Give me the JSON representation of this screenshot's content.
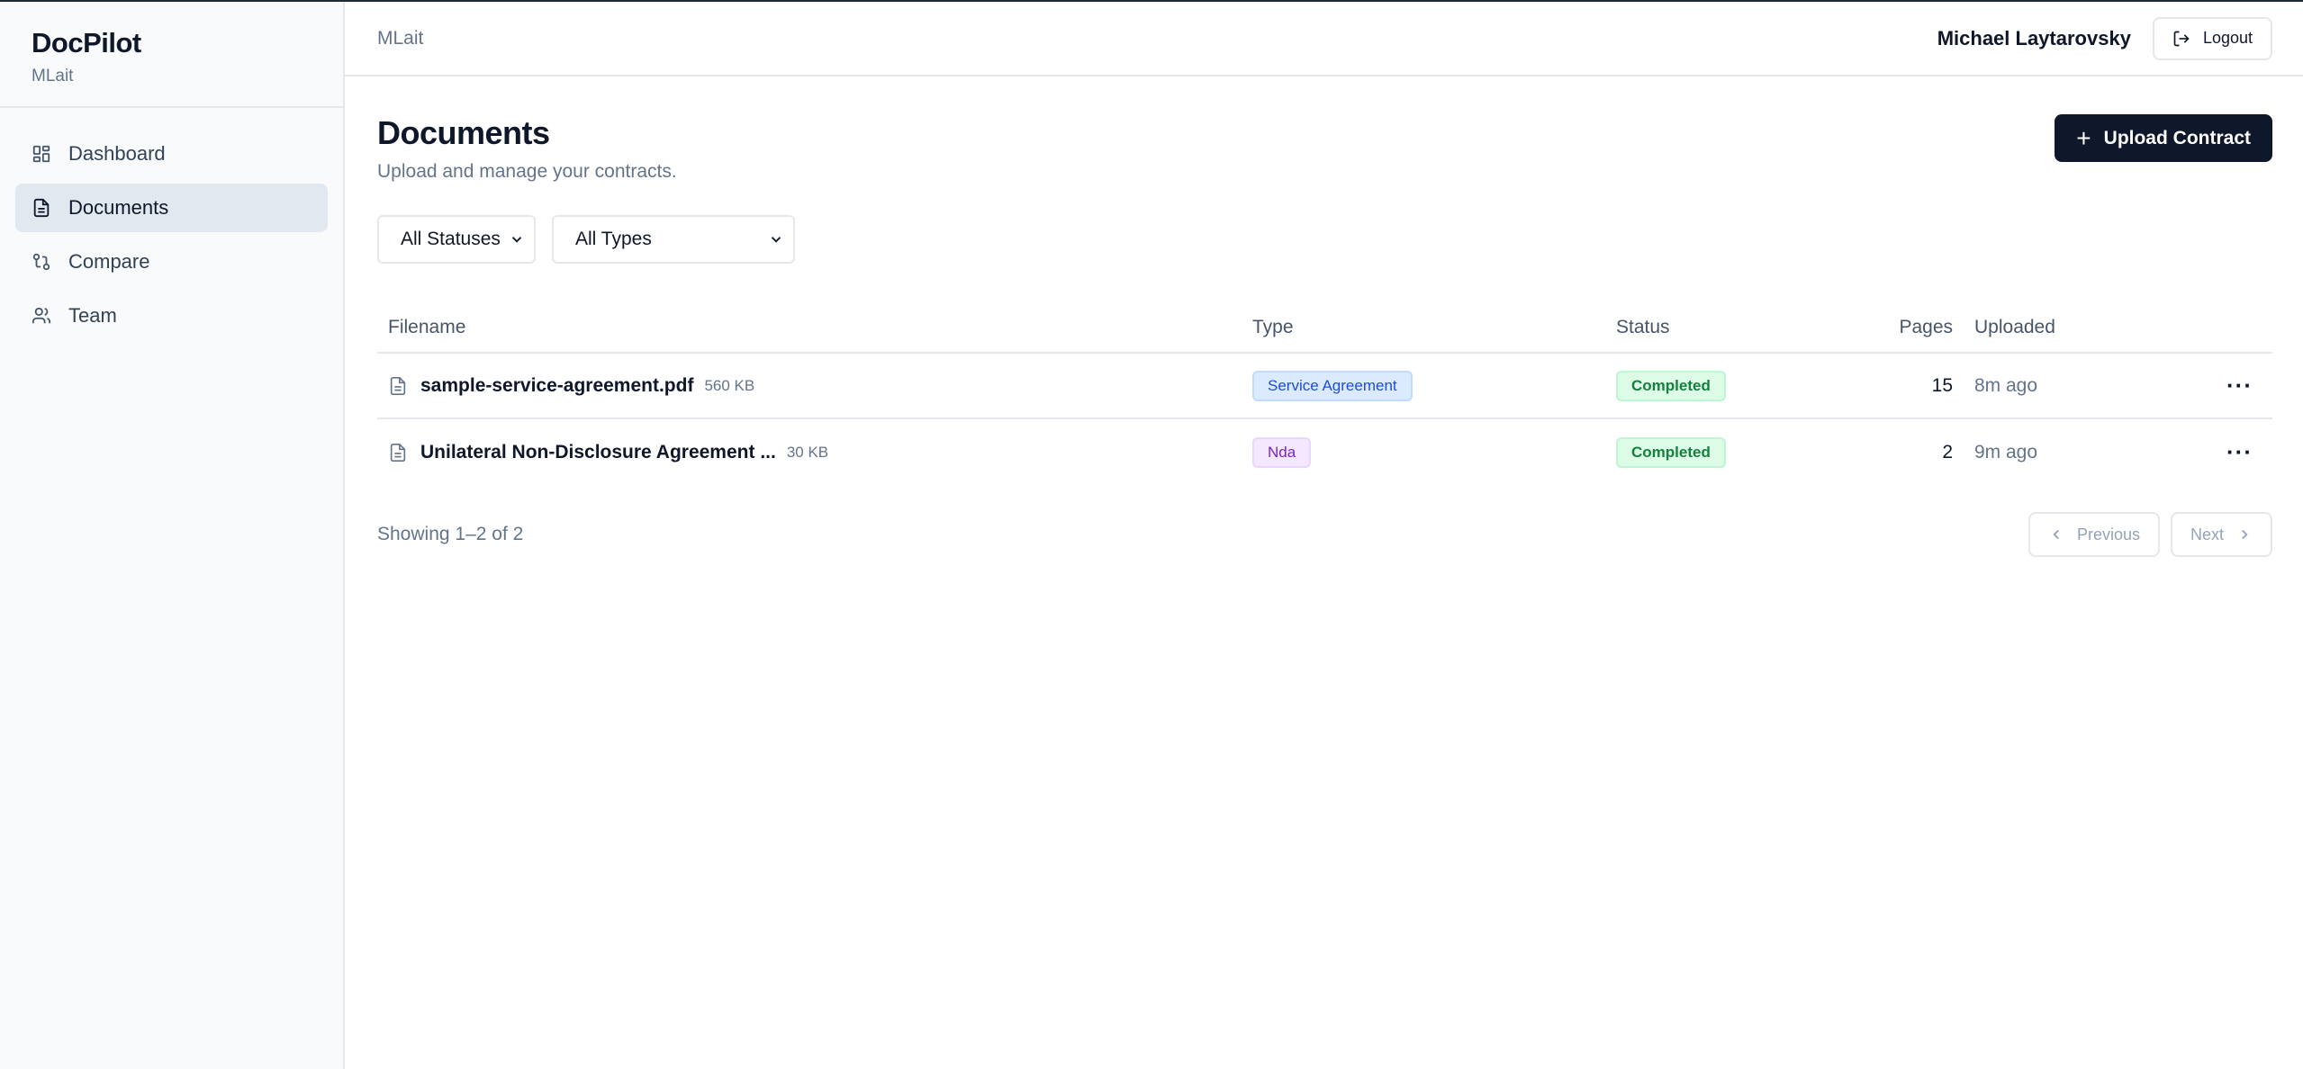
{
  "sidebar": {
    "brand": "DocPilot",
    "org": "MLait",
    "items": [
      {
        "label": "Dashboard",
        "icon": "dashboard-icon",
        "active": false
      },
      {
        "label": "Documents",
        "icon": "document-icon",
        "active": true
      },
      {
        "label": "Compare",
        "icon": "compare-icon",
        "active": false
      },
      {
        "label": "Team",
        "icon": "team-icon",
        "active": false
      }
    ]
  },
  "topbar": {
    "org": "MLait",
    "user": "Michael Laytarovsky",
    "logout_label": "Logout"
  },
  "page": {
    "title": "Documents",
    "subtitle": "Upload and manage your contracts.",
    "upload_label": "Upload Contract"
  },
  "filters": {
    "status": "All Statuses",
    "type": "All Types"
  },
  "table": {
    "headers": {
      "filename": "Filename",
      "type": "Type",
      "status": "Status",
      "pages": "Pages",
      "uploaded": "Uploaded"
    },
    "rows": [
      {
        "name": "sample-service-agreement.pdf",
        "size": "560 KB",
        "type": "Service Agreement",
        "status": "Completed",
        "pages": "15",
        "uploaded": "8m ago"
      },
      {
        "name": "Unilateral Non-Disclosure Agreement ...",
        "size": "30 KB",
        "type": "Nda",
        "status": "Completed",
        "pages": "2",
        "uploaded": "9m ago"
      }
    ]
  },
  "pagination": {
    "showing": "Showing 1–2 of 2",
    "previous": "Previous",
    "next": "Next"
  },
  "colors": {
    "primary": "#0f172a",
    "badge_blue": "#1d4ed8",
    "badge_purple": "#7e22ce",
    "badge_green": "#15803d"
  }
}
